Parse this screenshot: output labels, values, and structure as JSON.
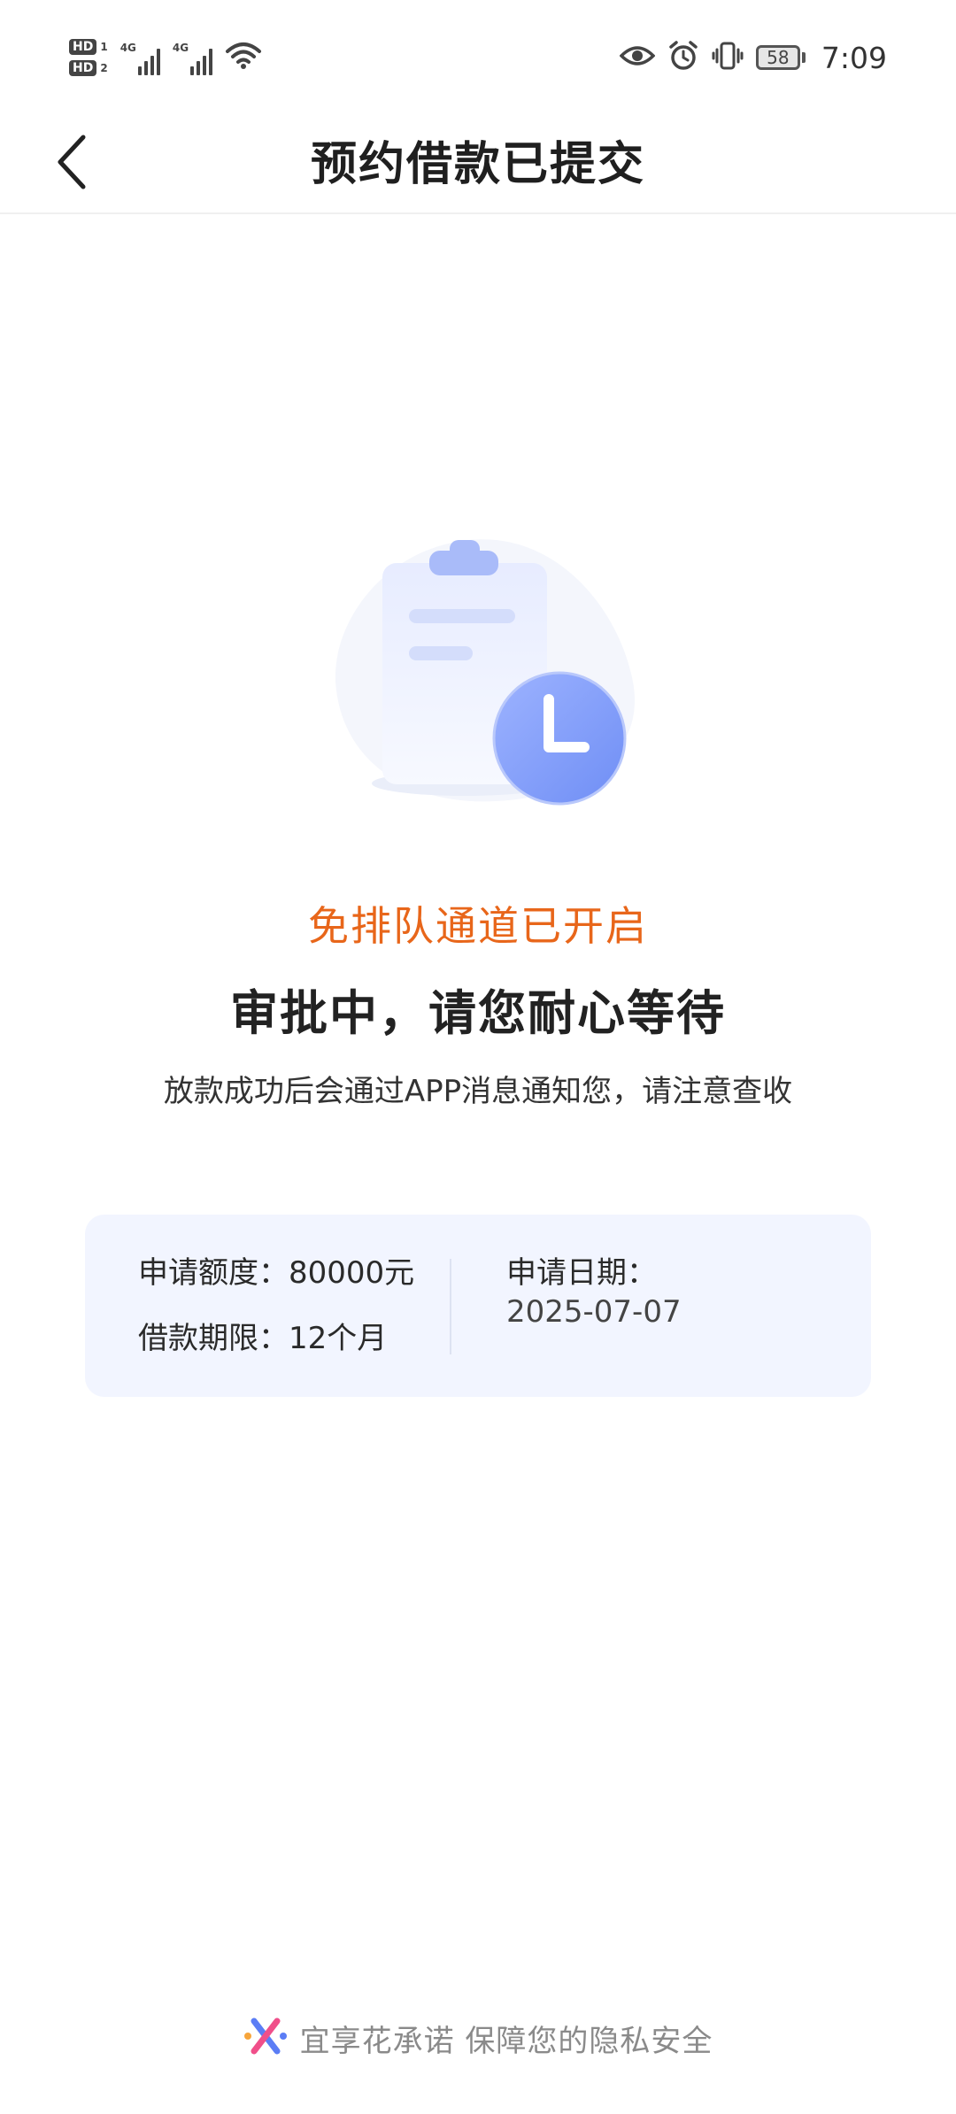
{
  "status_bar": {
    "hd1": "HD",
    "hd1_num": "1",
    "hd2": "HD",
    "hd2_num": "2",
    "net1": "4G",
    "net2": "4G",
    "battery": "58",
    "time": "7:09",
    "icons": [
      "eye-icon",
      "alarm-icon",
      "vibrate-icon",
      "battery-icon",
      "wifi-icon",
      "signal-icon"
    ]
  },
  "nav": {
    "title": "预约借款已提交",
    "back_icon": "chevron-left-icon"
  },
  "status": {
    "highlight": "免排队通道已开启",
    "headline": "审批中，请您耐心等待",
    "description": "放款成功后会通过APP消息通知您，请注意查收"
  },
  "info_card": {
    "amount_label": "申请额度：",
    "amount_value": "80000元",
    "term_label": "借款期限：",
    "term_value": "12个月",
    "date_label": "申请日期：",
    "date_value": "2025-07-07"
  },
  "footer": {
    "text": "宜享花承诺 保障您的隐私安全",
    "logo_icon": "brand-logo-icon"
  },
  "colors": {
    "accent_orange": "#e8661a",
    "card_bg": "#f2f5ff",
    "clock_blue": "#7f9bf8"
  }
}
